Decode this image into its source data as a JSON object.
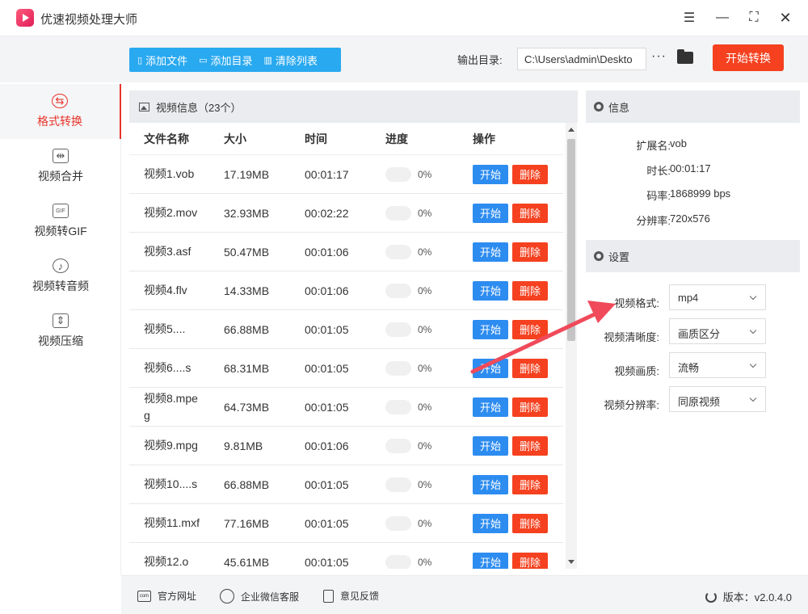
{
  "app": {
    "title": "优速视频处理大师"
  },
  "toolbar": {
    "add_file": "添加文件",
    "add_dir": "添加目录",
    "clear_list": "清除列表",
    "output_label": "输出目录:",
    "output_path": "C:\\Users\\admin\\Deskto",
    "more": "···",
    "start_convert": "开始转换"
  },
  "sidebar": {
    "items": [
      {
        "label": "格式转换",
        "icon": "format-convert-icon",
        "active": true
      },
      {
        "label": "视频合并",
        "icon": "merge-icon"
      },
      {
        "label": "视频转GIF",
        "icon": "gif-icon"
      },
      {
        "label": "视频转音频",
        "icon": "audio-icon"
      },
      {
        "label": "视频压缩",
        "icon": "compress-icon"
      }
    ]
  },
  "list": {
    "header": "视频信息（23个）",
    "columns": [
      "文件名称",
      "大小",
      "时间",
      "进度",
      "操作"
    ],
    "start_label": "开始",
    "delete_label": "删除",
    "rows": [
      {
        "name": "视频1.vob",
        "size": "17.19MB",
        "time": "00:01:17",
        "progress": "0%"
      },
      {
        "name": "视频2.mov",
        "size": "32.93MB",
        "time": "00:02:22",
        "progress": "0%"
      },
      {
        "name": "视频3.asf",
        "size": "50.47MB",
        "time": "00:01:06",
        "progress": "0%"
      },
      {
        "name": "视频4.flv",
        "size": "14.33MB",
        "time": "00:01:06",
        "progress": "0%"
      },
      {
        "name": "视频5....",
        "size": "66.88MB",
        "time": "00:01:05",
        "progress": "0%"
      },
      {
        "name": "视频6....s",
        "size": "68.31MB",
        "time": "00:01:05",
        "progress": "0%"
      },
      {
        "name": "视频8.mpeg",
        "size": "64.73MB",
        "time": "00:01:05",
        "progress": "0%"
      },
      {
        "name": "视频9.mpg",
        "size": "9.81MB",
        "time": "00:01:06",
        "progress": "0%"
      },
      {
        "name": "视频10....s",
        "size": "66.88MB",
        "time": "00:01:05",
        "progress": "0%"
      },
      {
        "name": "视频11.mxf",
        "size": "77.16MB",
        "time": "00:01:05",
        "progress": "0%"
      },
      {
        "name": "视频12.o",
        "size": "45.61MB",
        "time": "00:01:05",
        "progress": "0%"
      }
    ]
  },
  "info": {
    "header": "信息",
    "ext_label": "扩展名:",
    "ext_value": "vob",
    "dur_label": "时长:",
    "dur_value": "00:01:17",
    "rate_label": "码率:",
    "rate_value": "1868999 bps",
    "res_label": "分辨率:",
    "res_value": "720x576"
  },
  "settings": {
    "header": "设置",
    "format_label": "视频格式:",
    "format_value": "mp4",
    "clarity_label": "视频清晰度:",
    "clarity_value": "画质区分",
    "quality_label": "视频画质:",
    "quality_value": "流畅",
    "resolution_label": "视频分辨率:",
    "resolution_value": "同原视频"
  },
  "footer": {
    "website": "官方网址",
    "wechat": "企业微信客服",
    "feedback": "意见反馈",
    "version": "版本：v2.0.4.0"
  },
  "colors": {
    "accent_red": "#f5411f",
    "accent_blue": "#2d8cf0",
    "toolbar_blue": "#29a9f0"
  }
}
